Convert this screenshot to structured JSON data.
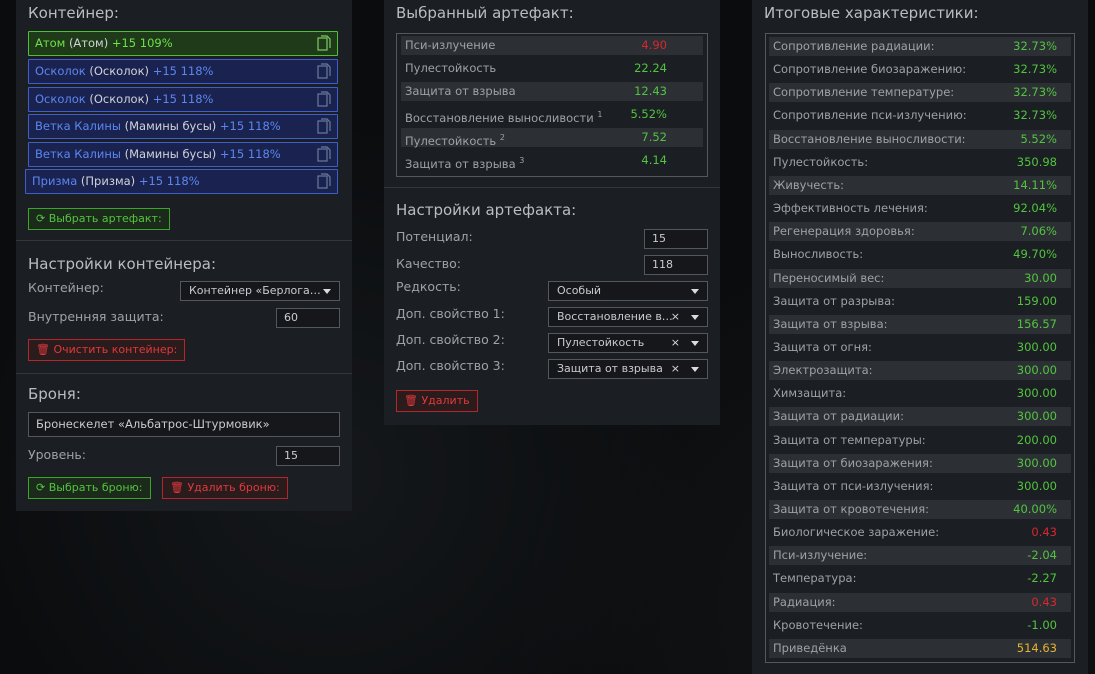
{
  "container_panel": {
    "title": "Контейнер:",
    "slots": [
      {
        "name": "Атом",
        "sub": "(Атом)",
        "level": "+15 109%"
      },
      {
        "name": "Осколок",
        "sub": "(Осколок)",
        "level": "+15 118%"
      },
      {
        "name": "Осколок",
        "sub": "(Осколок)",
        "level": "+15 118%"
      },
      {
        "name": "Ветка Калины",
        "sub": "(Мамины бусы)",
        "level": "+15 118%"
      },
      {
        "name": "Ветка Калины",
        "sub": "(Мамины бусы)",
        "level": "+15 118%"
      },
      {
        "name": "Призма",
        "sub": "(Призма)",
        "level": "+15 118%"
      }
    ],
    "choose_artifact": "Выбрать артефакт:",
    "settings_title": "Настройки контейнера:",
    "container_label": "Контейнер:",
    "container_value": "Контейнер «Берлога…",
    "inner_protection_label": "Внутренняя защита:",
    "inner_protection_value": "60",
    "clear_button": "Очистить контейнер:"
  },
  "armor_panel": {
    "title": "Броня:",
    "armor_name": "Бронескелет «Альбатрос-Штурмовик»",
    "level_label": "Уровень:",
    "level_value": "15",
    "choose_button": "Выбрать броню:",
    "delete_button": "Удалить броню:"
  },
  "artifact_panel": {
    "title": "Выбранный артефакт:",
    "stats": [
      {
        "label": "Пси-излучение",
        "sup": "",
        "value": "4.90",
        "tone": "red"
      },
      {
        "label": "Пулестойкость",
        "sup": "",
        "value": "22.24",
        "tone": "green"
      },
      {
        "label": "Защита от взрыва",
        "sup": "",
        "value": "12.43",
        "tone": "green"
      },
      {
        "label": "Восстановление выносливости",
        "sup": "1",
        "value": "5.52%",
        "tone": "green"
      },
      {
        "label": "Пулестойкость",
        "sup": "2",
        "value": "7.52",
        "tone": "green"
      },
      {
        "label": "Защита от взрыва",
        "sup": "3",
        "value": "4.14",
        "tone": "green"
      }
    ],
    "settings_title": "Настройки артефакта:",
    "potential_label": "Потенциал:",
    "potential_value": "15",
    "quality_label": "Качество:",
    "quality_value": "118",
    "rarity_label": "Редкость:",
    "rarity_value": "Особый",
    "extra1_label": "Доп. свойство 1:",
    "extra1_value": "Восстановление в…",
    "extra2_label": "Доп. свойство 2:",
    "extra2_value": "Пулестойкость",
    "extra3_label": "Доп. свойство 3:",
    "extra3_value": "Защита от взрыва",
    "clear_x": "×",
    "delete_button": "Удалить"
  },
  "totals_panel": {
    "title": "Итоговые характеристики:",
    "stats": [
      {
        "label": "Сопротивление радиации:",
        "value": "32.73%",
        "tone": "green"
      },
      {
        "label": "Сопротивление биозаражению:",
        "value": "32.73%",
        "tone": "green"
      },
      {
        "label": "Сопротивление температуре:",
        "value": "32.73%",
        "tone": "green"
      },
      {
        "label": "Сопротивление пси-излучению:",
        "value": "32.73%",
        "tone": "green"
      },
      {
        "label": "Восстановление выносливости:",
        "value": "5.52%",
        "tone": "green"
      },
      {
        "label": "Пулестойкость:",
        "value": "350.98",
        "tone": "green"
      },
      {
        "label": "Живучесть:",
        "value": "14.11%",
        "tone": "green"
      },
      {
        "label": "Эффективность лечения:",
        "value": "92.04%",
        "tone": "green"
      },
      {
        "label": "Регенерация здоровья:",
        "value": "7.06%",
        "tone": "green"
      },
      {
        "label": "Выносливость:",
        "value": "49.70%",
        "tone": "green"
      },
      {
        "label": "Переносимый вес:",
        "value": "30.00",
        "tone": "green"
      },
      {
        "label": "Защита от разрыва:",
        "value": "159.00",
        "tone": "green"
      },
      {
        "label": "Защита от взрыва:",
        "value": "156.57",
        "tone": "green"
      },
      {
        "label": "Защита от огня:",
        "value": "300.00",
        "tone": "green"
      },
      {
        "label": "Электрозащита:",
        "value": "300.00",
        "tone": "green"
      },
      {
        "label": "Химзащита:",
        "value": "300.00",
        "tone": "green"
      },
      {
        "label": "Защита от радиации:",
        "value": "300.00",
        "tone": "green"
      },
      {
        "label": "Защита от температуры:",
        "value": "200.00",
        "tone": "green"
      },
      {
        "label": "Защита от биозаражения:",
        "value": "300.00",
        "tone": "green"
      },
      {
        "label": "Защита от пси-излучения:",
        "value": "300.00",
        "tone": "green"
      },
      {
        "label": "Защита от кровотечения:",
        "value": "40.00%",
        "tone": "green"
      },
      {
        "label": "Биологическое заражение:",
        "value": "0.43",
        "tone": "red"
      },
      {
        "label": "Пси-излучение:",
        "value": "-2.04",
        "tone": "green"
      },
      {
        "label": "Температура:",
        "value": "-2.27",
        "tone": "green"
      },
      {
        "label": "Радиация:",
        "value": "0.43",
        "tone": "red"
      },
      {
        "label": "Кровотечение:",
        "value": "-1.00",
        "tone": "green"
      },
      {
        "label": "Приведёнка",
        "value": "514.63",
        "tone": "orange"
      }
    ]
  },
  "colors": {
    "green": "#52c43f",
    "red": "#d6282c",
    "orange": "#e8b32e",
    "blue": "#5b86f0"
  }
}
